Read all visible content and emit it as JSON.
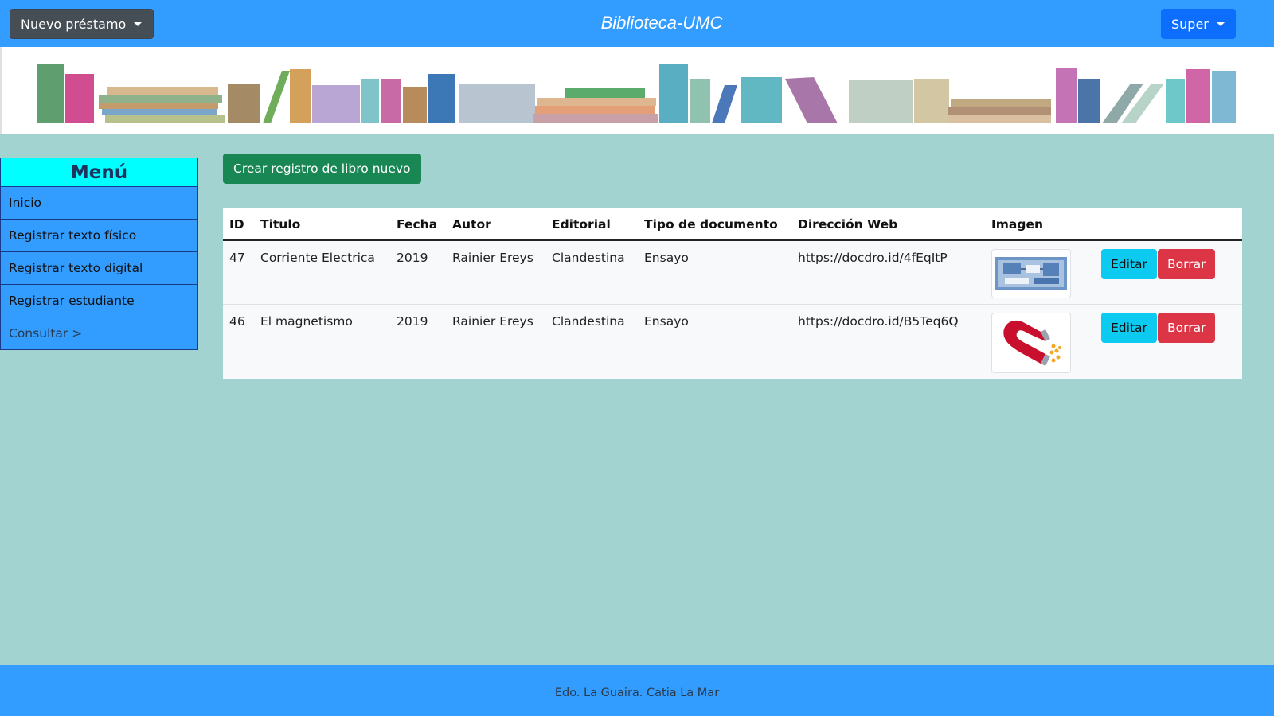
{
  "topbar": {
    "loan_button": "Nuevo préstamo",
    "brand": "Biblioteca-UMC",
    "user_button": "Super"
  },
  "sidebar": {
    "title": "Menú",
    "items": [
      {
        "label": "Inicio"
      },
      {
        "label": "Registrar texto físico"
      },
      {
        "label": "Registrar texto digital"
      },
      {
        "label": "Registrar estudiante"
      },
      {
        "label": "Consultar >"
      }
    ]
  },
  "main": {
    "create_button": "Crear registro de libro nuevo",
    "table": {
      "headers": [
        "ID",
        "Titulo",
        "Fecha",
        "Autor",
        "Editorial",
        "Tipo de documento",
        "Dirección Web",
        "Imagen"
      ],
      "rows": [
        {
          "id": "47",
          "titulo": "Corriente Electrica",
          "fecha": "2019",
          "autor": "Rainier Ereys",
          "editorial": "Clandestina",
          "tipo": "Ensayo",
          "web": "https://docdro.id/4fEqItP",
          "image": "circuit-thumbnail"
        },
        {
          "id": "46",
          "titulo": "El magnetismo",
          "fecha": "2019",
          "autor": "Rainier Ereys",
          "editorial": "Clandestina",
          "tipo": "Ensayo",
          "web": "https://docdro.id/B5Teq6Q",
          "image": "magnet-thumbnail"
        }
      ],
      "edit_label": "Editar",
      "delete_label": "Borrar"
    }
  },
  "footer": {
    "text": "Edo. La Guaira. Catia La Mar"
  },
  "colors": {
    "topbar": "#339cff",
    "background": "#a3d3d0",
    "menu_title": "#00ffff",
    "create": "#198754",
    "edit": "#0dcaf0",
    "delete": "#dc3545"
  }
}
